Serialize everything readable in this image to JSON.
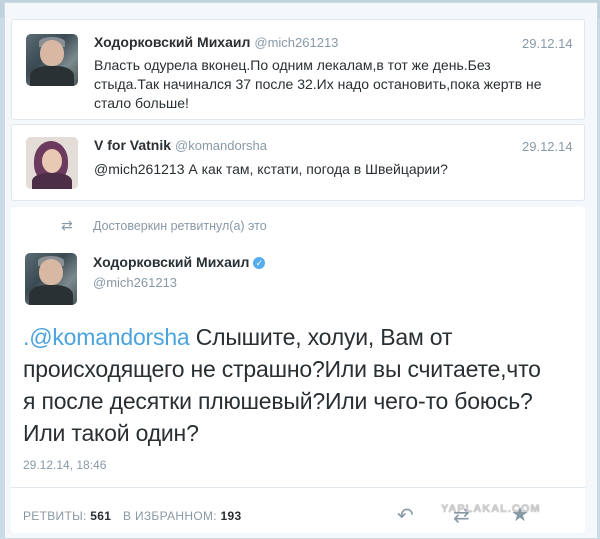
{
  "tweet1": {
    "name": "Ходорковский Михаил",
    "handle": "@mich261213",
    "date": "29.12.14",
    "lines": [
      "Власть одурела вконец.По одним лекалам,в тот же день.Без",
      "стыда.Так начинался 37 после 32.Их надо остановить,пока жертв не",
      "стало больше!"
    ]
  },
  "tweet2": {
    "name": "V for Vatnik",
    "handle": "@komandorsha",
    "date": "29.12.14",
    "text": "@mich261213 А как там, кстати, погода в Швейцарии?"
  },
  "retweet_notice": "Достоверкин ретвитнул(а) это",
  "main_tweet": {
    "name": "Ходорковский Михаил",
    "handle": "@mich261213",
    "mention": ".@komandorsha",
    "lines": [
      " Слышите, холуи, Вам от",
      "происходящего не страшно?Или вы считаете,что",
      "я после десятки плюшевый?Или чего-то боюсь?",
      "Или такой один?"
    ],
    "timestamp": "29.12.14, 18:46",
    "retweets_label": "РЕТВИТЫ:",
    "retweets_count": "561",
    "favorites_label": "В ИЗБРАННОМ:",
    "favorites_count": "193"
  },
  "icons": {
    "reply": "reply-icon",
    "retweet": "retweet-icon",
    "favorite": "star-icon",
    "verified": "verified-icon"
  },
  "watermark": "YAPLAKAL.COM",
  "colors": {
    "link": "#4aa3df",
    "muted": "#8899a6",
    "verified": "#55acee"
  }
}
